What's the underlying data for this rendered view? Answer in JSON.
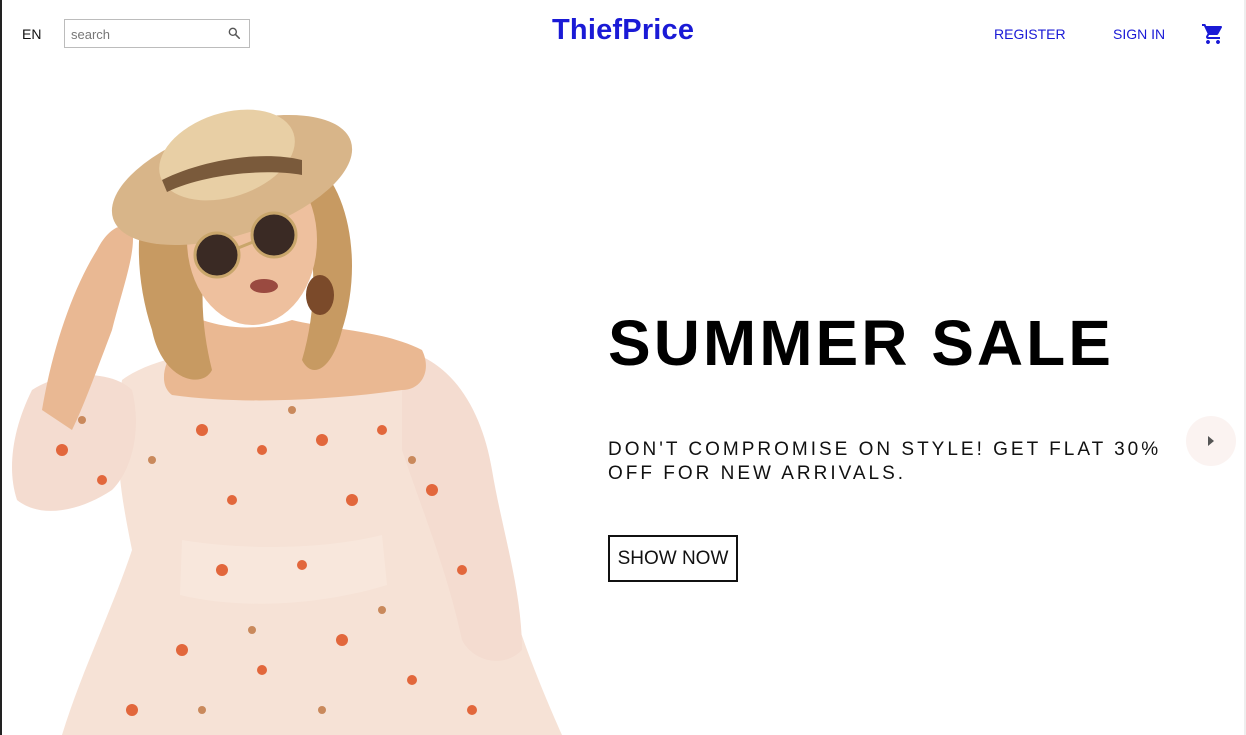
{
  "header": {
    "language": "EN",
    "search": {
      "placeholder": "search",
      "value": ""
    },
    "logo": "ThiefPrice",
    "register_label": "REGISTER",
    "signin_label": "SIGN IN",
    "cart_icon": "shopping-cart-icon"
  },
  "hero": {
    "title": "SUMMER SALE",
    "description": "DON'T COMPROMISE ON STYLE! GET FLAT 30% OFF FOR NEW ARRIVALS.",
    "button_label": "SHOW NOW",
    "next_arrow_icon": "arrow-right-icon"
  },
  "colors": {
    "brand": "#1a1ad6",
    "text": "#000000",
    "arrow_bg": "#fbf3f1"
  }
}
